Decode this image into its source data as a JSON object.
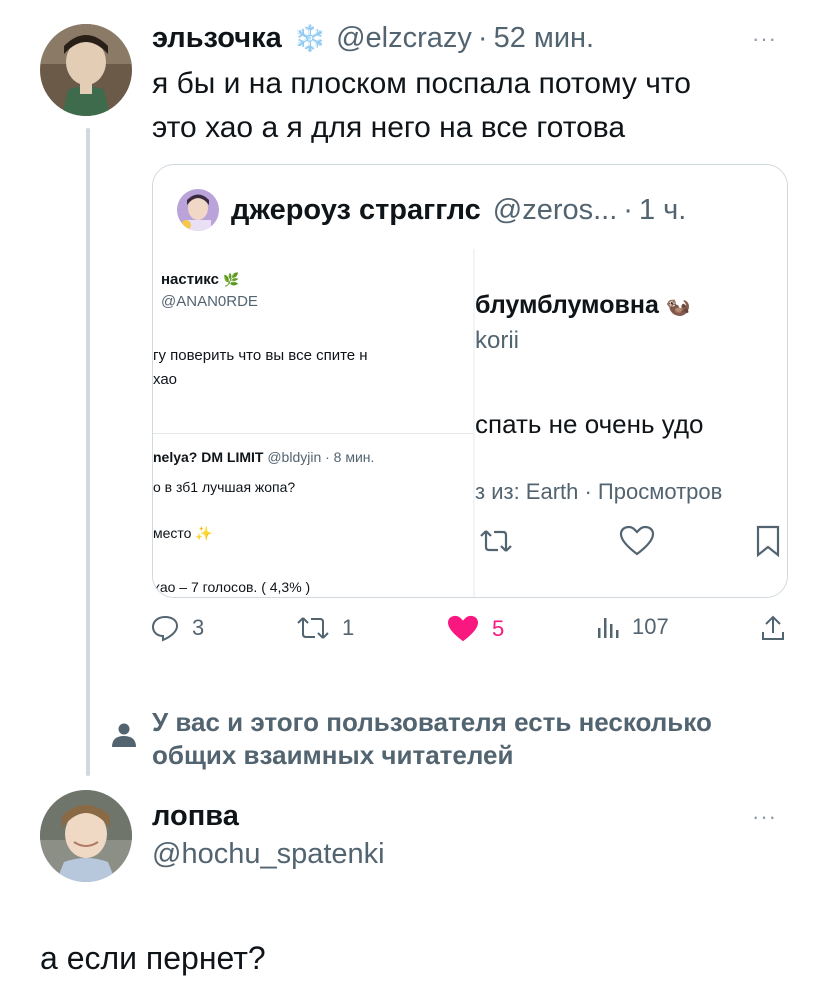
{
  "tweet": {
    "author_name": "эльзочка",
    "author_emoji": "❄️",
    "handle": "@elzcrazy",
    "time": "52 мин.",
    "text_line1": "я бы и на плоском поспала потому что",
    "text_line2": "это хао а я для него  на все готова",
    "more": "···",
    "actions": {
      "replies": "3",
      "retweets": "1",
      "likes": "5",
      "views": "107"
    },
    "colors": {
      "like": "#f91880",
      "muted": "#536471",
      "text": "#0f1419"
    }
  },
  "quote": {
    "author_name": "джероуз страгглс",
    "handle": "@zeros...",
    "time": "1 ч.",
    "left_image": {
      "name": "настикс",
      "name_emoji": "🌿",
      "handle": "@ANAN0RDE",
      "text1": "гу поверить что вы все спите н",
      "text2": "хао",
      "name2": "nelya? DM LIMIT",
      "handle2": "@bldyjin · 8 мин.",
      "text3": "о в зб1 лучшая жопа?",
      "text4": "место",
      "text4_emoji": "✨",
      "text5": "хао – 7 голосов. ( 4,3% )"
    },
    "right_image": {
      "name": "блумблумовна",
      "name_emoji": "🦦",
      "handle": "korii",
      "text1": "спать не очень удо",
      "meta": "з из: Earth · Просмотров"
    }
  },
  "mutual_text": "У вас и этого пользователя есть несколько общих взаимных читателей",
  "reply": {
    "name": "лопва",
    "handle": "@hochu_spatenki",
    "text": "а если пернет?",
    "more": "···"
  }
}
